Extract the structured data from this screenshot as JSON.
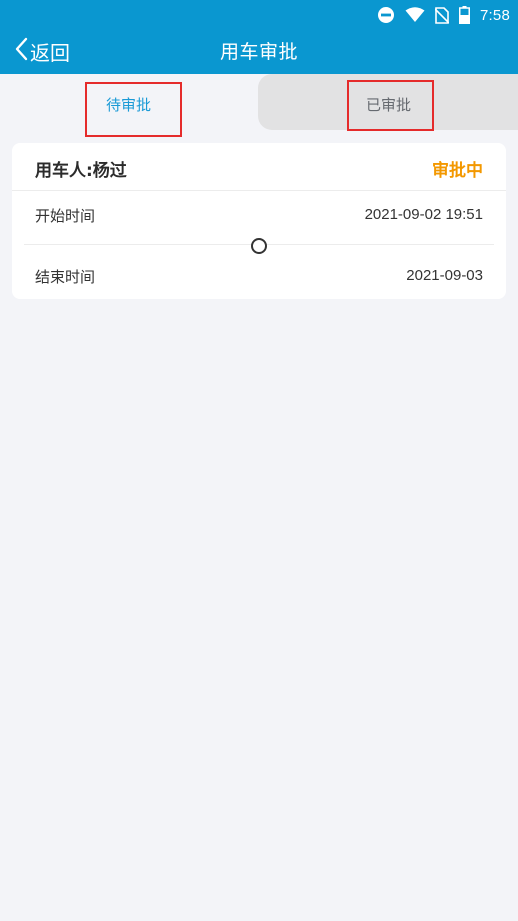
{
  "status_bar": {
    "time": "7:58",
    "icons": [
      "do-not-disturb-icon",
      "wifi-icon",
      "no-sim-icon",
      "battery-icon"
    ]
  },
  "nav": {
    "back_label": "返回",
    "title": "用车审批"
  },
  "tabs": [
    {
      "label": "待审批",
      "active": true
    },
    {
      "label": "已审批",
      "active": false
    }
  ],
  "record": {
    "user": "用车人:杨过",
    "status": "审批中",
    "start_label": "开始时间",
    "start_value": "2021-09-02 19:51",
    "end_label": "结束时间",
    "end_value": "2021-09-03"
  },
  "colors": {
    "header": "#0a97d0",
    "active_tab": "#1a9ad6",
    "status_pending": "#f39800",
    "highlight": "#e52b2b",
    "background": "#f3f4f8"
  }
}
